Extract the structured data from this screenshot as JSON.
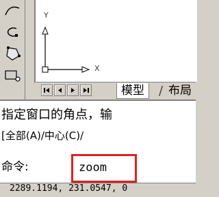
{
  "toolbar": {
    "icons": [
      "arc-icon",
      "revision-cloud-icon",
      "polygon-select-icon",
      "boundary-icon"
    ]
  },
  "canvas": {
    "ucs_x_label": "X",
    "ucs_y_label": "Y"
  },
  "tabs": {
    "model": "模型",
    "layout": "布局"
  },
  "console": {
    "line1": "指定窗口的角点，输",
    "line2": "[全部(A)/中心(C)/",
    "prompt": "命令:",
    "input_value": "zoom"
  },
  "status": {
    "coordinates": "2289.1194, 231.0547, 0"
  },
  "colors": {
    "highlight": "#e02020",
    "chrome": "#d4d0c8"
  }
}
